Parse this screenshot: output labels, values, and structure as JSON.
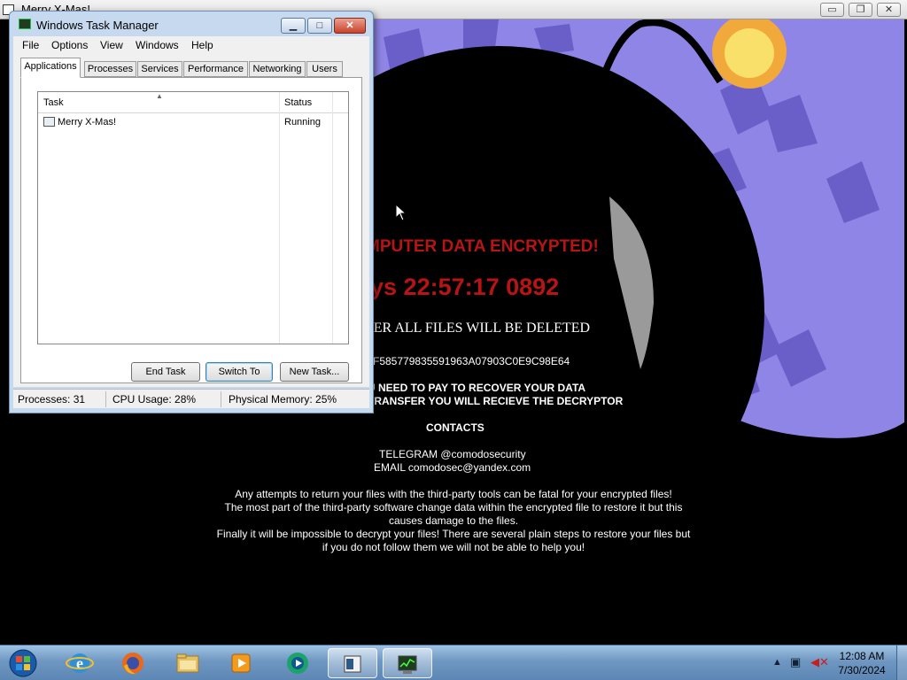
{
  "background_window": {
    "title": "Merry X-Mas!",
    "controls": {
      "minimize": "▭",
      "restore": "❐",
      "close": "✕"
    }
  },
  "ransom_note": {
    "headline": "MPUTER DATA ENCRYPTED!",
    "timer": "ays 22:57:17 0892",
    "deletion_warning": "TER ALL FILES WILL BE DELETED",
    "id": "F585779835591963A07903C0E9C98E64",
    "pay_line": "U NEED TO PAY TO RECOVER YOUR DATA",
    "transfer_line": "TRANSFER YOU WILL RECIEVE THE DECRYPTOR",
    "contacts_heading": "CONTACTS",
    "telegram": "TELEGRAM @comodosecurity",
    "email": "EMAIL comodosec@yandex.com",
    "warning_lines": [
      "Any attempts to return your files with the third-party tools can be fatal for your encrypted files!",
      "The most part of the third-party software change data within the encrypted file to restore it but this causes damage to the files.",
      "Finally it will be impossible to decrypt your files! There are several plain steps to restore your files but if you do not follow them we will not be able to help you!"
    ]
  },
  "task_manager": {
    "title": "Windows Task Manager",
    "controls": {
      "minimize": "▁",
      "maximize": "□",
      "close": "✕"
    },
    "menu": [
      "File",
      "Options",
      "View",
      "Windows",
      "Help"
    ],
    "tabs": [
      "Applications",
      "Processes",
      "Services",
      "Performance",
      "Networking",
      "Users"
    ],
    "active_tab": "Applications",
    "columns": {
      "task": "Task",
      "status": "Status"
    },
    "rows": [
      {
        "task": "Merry X-Mas!",
        "status": "Running"
      }
    ],
    "buttons": {
      "end_task": "End Task",
      "switch_to": "Switch To",
      "new_task": "New Task..."
    },
    "status_bar": {
      "processes": "Processes: 31",
      "cpu": "CPU Usage: 28%",
      "memory": "Physical Memory: 25%"
    }
  },
  "taskbar": {
    "start_icon": "windows-orb-icon",
    "pinned": [
      "internet-explorer-icon",
      "firefox-icon",
      "file-explorer-icon",
      "media-player-icon",
      "media-center-icon",
      "merry-xmas-app-icon",
      "task-manager-icon"
    ],
    "clock_time": "12:08 AM",
    "clock_date": "7/30/2024"
  },
  "colors": {
    "ransom_red": "#b81414",
    "bomb_purple": "#8f85e6",
    "taskbar_blue": "#6f97c2"
  }
}
